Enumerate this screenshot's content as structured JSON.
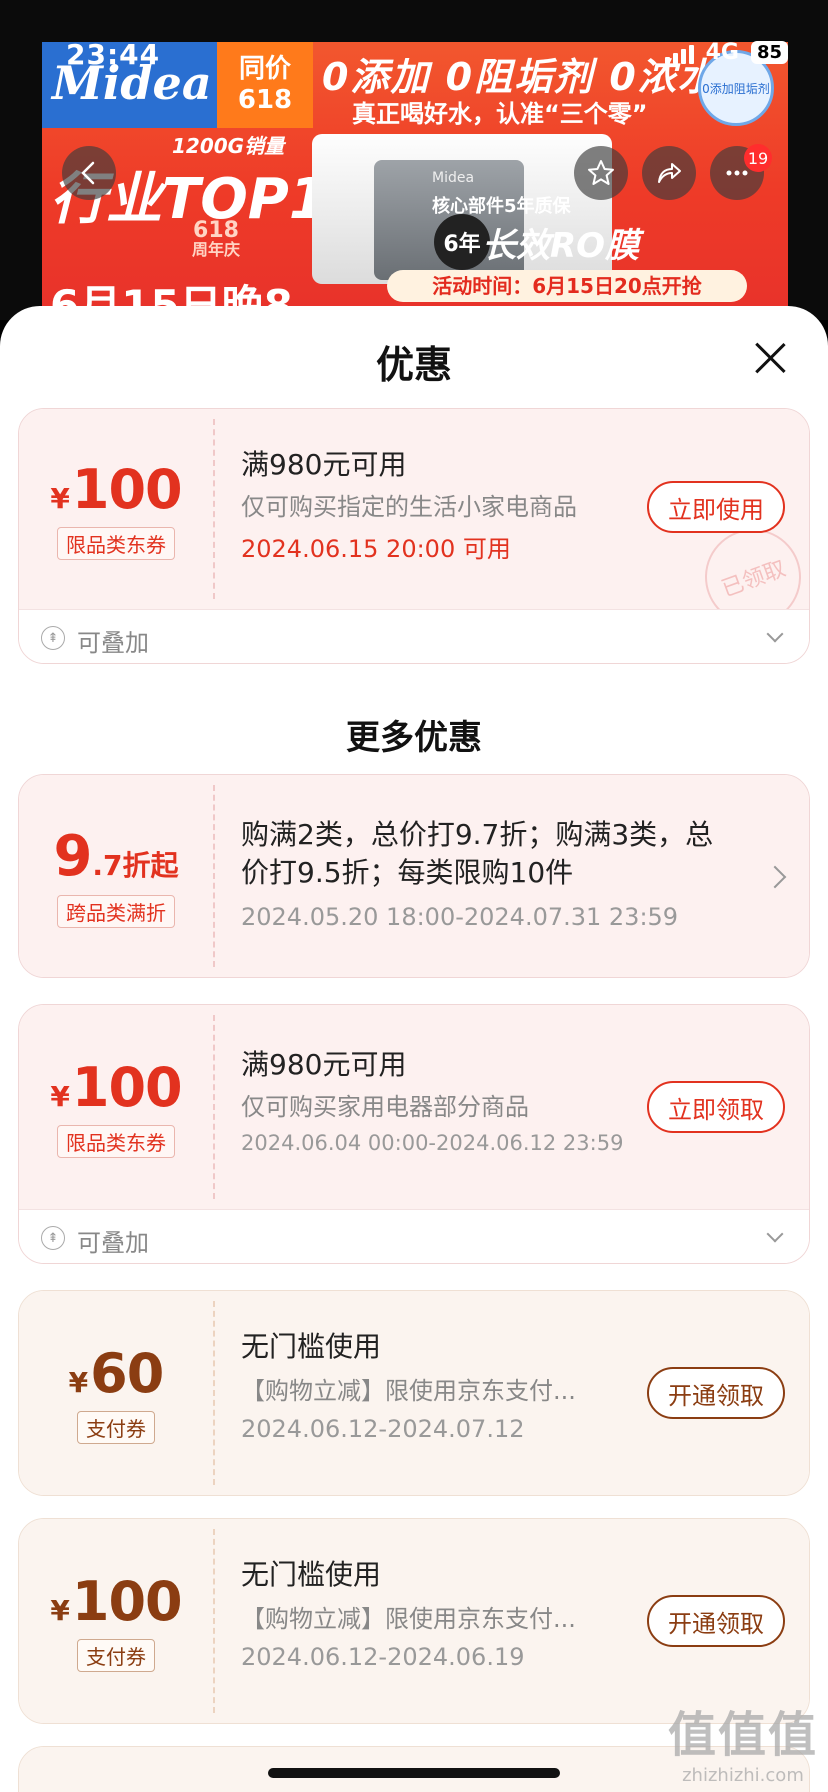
{
  "status_bar": {
    "time": "23:44",
    "network": "4G",
    "battery": "85"
  },
  "banner": {
    "brand": "Midea",
    "price_line1": "同价",
    "price_line2": "618",
    "slogan": "0添加 0阻垢剂 0浓水",
    "sub_slogan": "真正喝好水，认准“三个零”",
    "eco_badge": "0添加阻垢剂",
    "sales": "1200G销量",
    "rank": "行业TOP1",
    "anniversary_1": "618",
    "anniversary_2": "周年庆",
    "date_promo": "6月15日晚8",
    "product_label": "Midea",
    "warranty": "核心部件5年质保",
    "six_year": "6年",
    "ro_label": "长效RO膜",
    "event_time": "活动时间：6月15日20点开抢",
    "cart_badge": "19"
  },
  "sheet": {
    "title": "优惠",
    "more_title": "更多优惠"
  },
  "coupons": [
    {
      "currency": "¥",
      "amount": "100",
      "tag": "限品类东券",
      "condition": "满980元可用",
      "desc": "仅可购买指定的生活小家电商品",
      "time": "2024.06.15 20:00 可用",
      "button": "立即使用",
      "stamp": "已领取",
      "stack_label": "可叠加"
    },
    {
      "discount_big": "9",
      "discount_small": ".7折起",
      "tag": "跨品类满折",
      "desc_line1": "购满2类，总价打9.7折；购满3类，总",
      "desc_line2": "价打9.5折；每类限购10件",
      "time": "2024.05.20 18:00-2024.07.31 23:59"
    },
    {
      "currency": "¥",
      "amount": "100",
      "tag": "限品类东券",
      "condition": "满980元可用",
      "desc": "仅可购买家用电器部分商品",
      "time": "2024.06.04 00:00-2024.06.12 23:59",
      "button": "立即领取",
      "stack_label": "可叠加"
    },
    {
      "currency": "¥",
      "amount": "60",
      "tag": "支付券",
      "condition": "无门槛使用",
      "desc": "【购物立减】限使用京东支付...",
      "time": "2024.06.12-2024.07.12",
      "button": "开通领取"
    },
    {
      "currency": "¥",
      "amount": "100",
      "tag": "支付券",
      "condition": "无门槛使用",
      "desc": "【购物立减】限使用京东支付...",
      "time": "2024.06.12-2024.06.19",
      "button": "开通领取"
    }
  ],
  "watermark": {
    "line1": "值值值",
    "line2": "zhizhizhi.com"
  }
}
